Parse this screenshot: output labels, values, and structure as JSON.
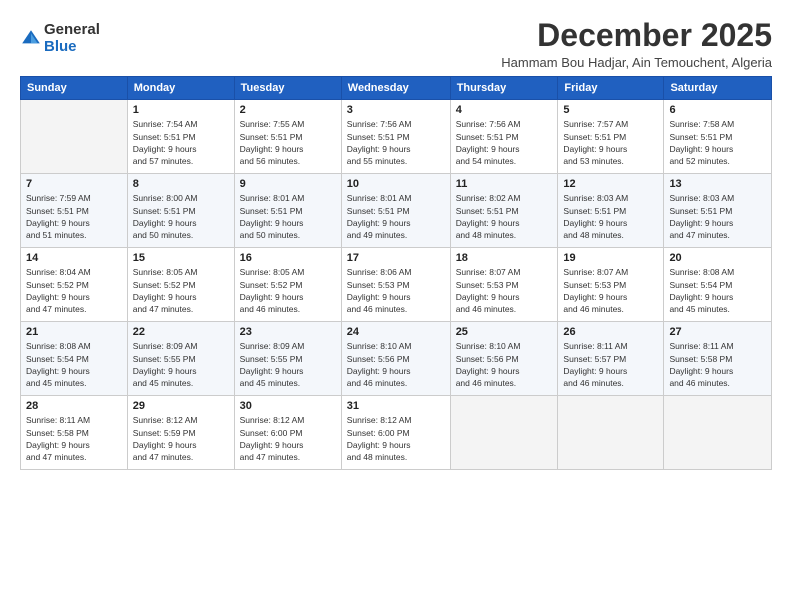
{
  "header": {
    "logo_general": "General",
    "logo_blue": "Blue",
    "title": "December 2025",
    "subtitle": "Hammam Bou Hadjar, Ain Temouchent, Algeria"
  },
  "days_of_week": [
    "Sunday",
    "Monday",
    "Tuesday",
    "Wednesday",
    "Thursday",
    "Friday",
    "Saturday"
  ],
  "weeks": [
    [
      {
        "day": "",
        "info": ""
      },
      {
        "day": "1",
        "info": "Sunrise: 7:54 AM\nSunset: 5:51 PM\nDaylight: 9 hours\nand 57 minutes."
      },
      {
        "day": "2",
        "info": "Sunrise: 7:55 AM\nSunset: 5:51 PM\nDaylight: 9 hours\nand 56 minutes."
      },
      {
        "day": "3",
        "info": "Sunrise: 7:56 AM\nSunset: 5:51 PM\nDaylight: 9 hours\nand 55 minutes."
      },
      {
        "day": "4",
        "info": "Sunrise: 7:56 AM\nSunset: 5:51 PM\nDaylight: 9 hours\nand 54 minutes."
      },
      {
        "day": "5",
        "info": "Sunrise: 7:57 AM\nSunset: 5:51 PM\nDaylight: 9 hours\nand 53 minutes."
      },
      {
        "day": "6",
        "info": "Sunrise: 7:58 AM\nSunset: 5:51 PM\nDaylight: 9 hours\nand 52 minutes."
      }
    ],
    [
      {
        "day": "7",
        "info": "Sunrise: 7:59 AM\nSunset: 5:51 PM\nDaylight: 9 hours\nand 51 minutes."
      },
      {
        "day": "8",
        "info": "Sunrise: 8:00 AM\nSunset: 5:51 PM\nDaylight: 9 hours\nand 50 minutes."
      },
      {
        "day": "9",
        "info": "Sunrise: 8:01 AM\nSunset: 5:51 PM\nDaylight: 9 hours\nand 50 minutes."
      },
      {
        "day": "10",
        "info": "Sunrise: 8:01 AM\nSunset: 5:51 PM\nDaylight: 9 hours\nand 49 minutes."
      },
      {
        "day": "11",
        "info": "Sunrise: 8:02 AM\nSunset: 5:51 PM\nDaylight: 9 hours\nand 48 minutes."
      },
      {
        "day": "12",
        "info": "Sunrise: 8:03 AM\nSunset: 5:51 PM\nDaylight: 9 hours\nand 48 minutes."
      },
      {
        "day": "13",
        "info": "Sunrise: 8:03 AM\nSunset: 5:51 PM\nDaylight: 9 hours\nand 47 minutes."
      }
    ],
    [
      {
        "day": "14",
        "info": "Sunrise: 8:04 AM\nSunset: 5:52 PM\nDaylight: 9 hours\nand 47 minutes."
      },
      {
        "day": "15",
        "info": "Sunrise: 8:05 AM\nSunset: 5:52 PM\nDaylight: 9 hours\nand 47 minutes."
      },
      {
        "day": "16",
        "info": "Sunrise: 8:05 AM\nSunset: 5:52 PM\nDaylight: 9 hours\nand 46 minutes."
      },
      {
        "day": "17",
        "info": "Sunrise: 8:06 AM\nSunset: 5:53 PM\nDaylight: 9 hours\nand 46 minutes."
      },
      {
        "day": "18",
        "info": "Sunrise: 8:07 AM\nSunset: 5:53 PM\nDaylight: 9 hours\nand 46 minutes."
      },
      {
        "day": "19",
        "info": "Sunrise: 8:07 AM\nSunset: 5:53 PM\nDaylight: 9 hours\nand 46 minutes."
      },
      {
        "day": "20",
        "info": "Sunrise: 8:08 AM\nSunset: 5:54 PM\nDaylight: 9 hours\nand 45 minutes."
      }
    ],
    [
      {
        "day": "21",
        "info": "Sunrise: 8:08 AM\nSunset: 5:54 PM\nDaylight: 9 hours\nand 45 minutes."
      },
      {
        "day": "22",
        "info": "Sunrise: 8:09 AM\nSunset: 5:55 PM\nDaylight: 9 hours\nand 45 minutes."
      },
      {
        "day": "23",
        "info": "Sunrise: 8:09 AM\nSunset: 5:55 PM\nDaylight: 9 hours\nand 45 minutes."
      },
      {
        "day": "24",
        "info": "Sunrise: 8:10 AM\nSunset: 5:56 PM\nDaylight: 9 hours\nand 46 minutes."
      },
      {
        "day": "25",
        "info": "Sunrise: 8:10 AM\nSunset: 5:56 PM\nDaylight: 9 hours\nand 46 minutes."
      },
      {
        "day": "26",
        "info": "Sunrise: 8:11 AM\nSunset: 5:57 PM\nDaylight: 9 hours\nand 46 minutes."
      },
      {
        "day": "27",
        "info": "Sunrise: 8:11 AM\nSunset: 5:58 PM\nDaylight: 9 hours\nand 46 minutes."
      }
    ],
    [
      {
        "day": "28",
        "info": "Sunrise: 8:11 AM\nSunset: 5:58 PM\nDaylight: 9 hours\nand 47 minutes."
      },
      {
        "day": "29",
        "info": "Sunrise: 8:12 AM\nSunset: 5:59 PM\nDaylight: 9 hours\nand 47 minutes."
      },
      {
        "day": "30",
        "info": "Sunrise: 8:12 AM\nSunset: 6:00 PM\nDaylight: 9 hours\nand 47 minutes."
      },
      {
        "day": "31",
        "info": "Sunrise: 8:12 AM\nSunset: 6:00 PM\nDaylight: 9 hours\nand 48 minutes."
      },
      {
        "day": "",
        "info": ""
      },
      {
        "day": "",
        "info": ""
      },
      {
        "day": "",
        "info": ""
      }
    ]
  ]
}
